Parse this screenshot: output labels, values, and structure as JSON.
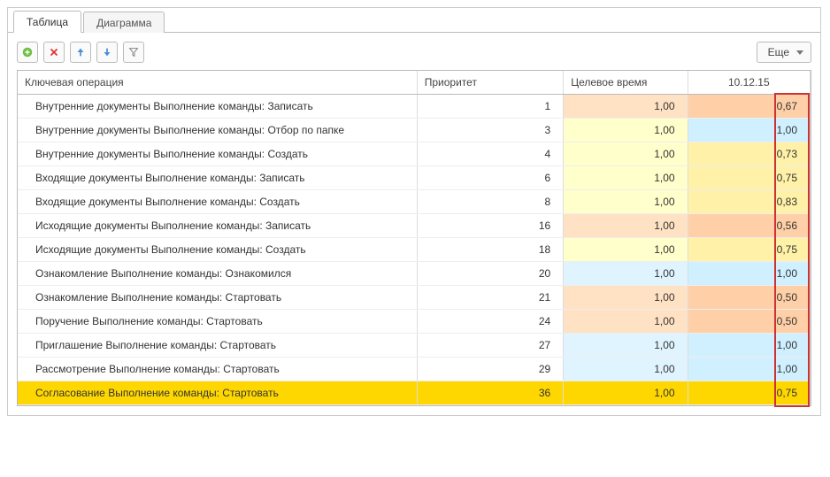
{
  "tabs": {
    "table": "Таблица",
    "chart": "Диаграмма"
  },
  "toolbar": {
    "more": "Еще"
  },
  "columns": {
    "operation": "Ключевая операция",
    "priority": "Приоритет",
    "target": "Целевое время",
    "date": "10.12.15"
  },
  "rows": [
    {
      "name": "Внутренние документы Выполнение команды: Записать",
      "pri": "1",
      "time": "1,00",
      "val": "0,67",
      "tc": "time-orange",
      "vc": "val-orange"
    },
    {
      "name": "Внутренние документы Выполнение команды: Отбор по папке",
      "pri": "3",
      "time": "1,00",
      "val": "1,00",
      "tc": "time-cell",
      "vc": "val-blue"
    },
    {
      "name": "Внутренние документы Выполнение команды: Создать",
      "pri": "4",
      "time": "1,00",
      "val": "0,73",
      "tc": "time-cell",
      "vc": "val-yellow"
    },
    {
      "name": "Входящие документы Выполнение команды: Записать",
      "pri": "6",
      "time": "1,00",
      "val": "0,75",
      "tc": "time-cell",
      "vc": "val-yellow"
    },
    {
      "name": "Входящие документы Выполнение команды: Создать",
      "pri": "8",
      "time": "1,00",
      "val": "0,83",
      "tc": "time-cell",
      "vc": "val-yellow"
    },
    {
      "name": "Исходящие документы Выполнение команды: Записать",
      "pri": "16",
      "time": "1,00",
      "val": "0,56",
      "tc": "time-orange",
      "vc": "val-orange"
    },
    {
      "name": "Исходящие документы Выполнение команды: Создать",
      "pri": "18",
      "time": "1,00",
      "val": "0,75",
      "tc": "time-cell",
      "vc": "val-yellow"
    },
    {
      "name": "Ознакомление Выполнение команды: Ознакомился",
      "pri": "20",
      "time": "1,00",
      "val": "1,00",
      "tc": "time-blue",
      "vc": "val-blue"
    },
    {
      "name": "Ознакомление Выполнение команды: Стартовать",
      "pri": "21",
      "time": "1,00",
      "val": "0,50",
      "tc": "time-orange",
      "vc": "val-orange"
    },
    {
      "name": "Поручение Выполнение команды: Стартовать",
      "pri": "24",
      "time": "1,00",
      "val": "0,50",
      "tc": "time-orange",
      "vc": "val-orange"
    },
    {
      "name": "Приглашение Выполнение команды: Стартовать",
      "pri": "27",
      "time": "1,00",
      "val": "1,00",
      "tc": "time-blue",
      "vc": "val-blue"
    },
    {
      "name": "Рассмотрение Выполнение команды: Стартовать",
      "pri": "29",
      "time": "1,00",
      "val": "1,00",
      "tc": "time-blue",
      "vc": "val-blue"
    },
    {
      "name": "Согласование Выполнение команды: Стартовать",
      "pri": "36",
      "time": "1,00",
      "val": "0,75",
      "tc": "time-cell",
      "vc": "val-yellow",
      "sel": true
    }
  ]
}
